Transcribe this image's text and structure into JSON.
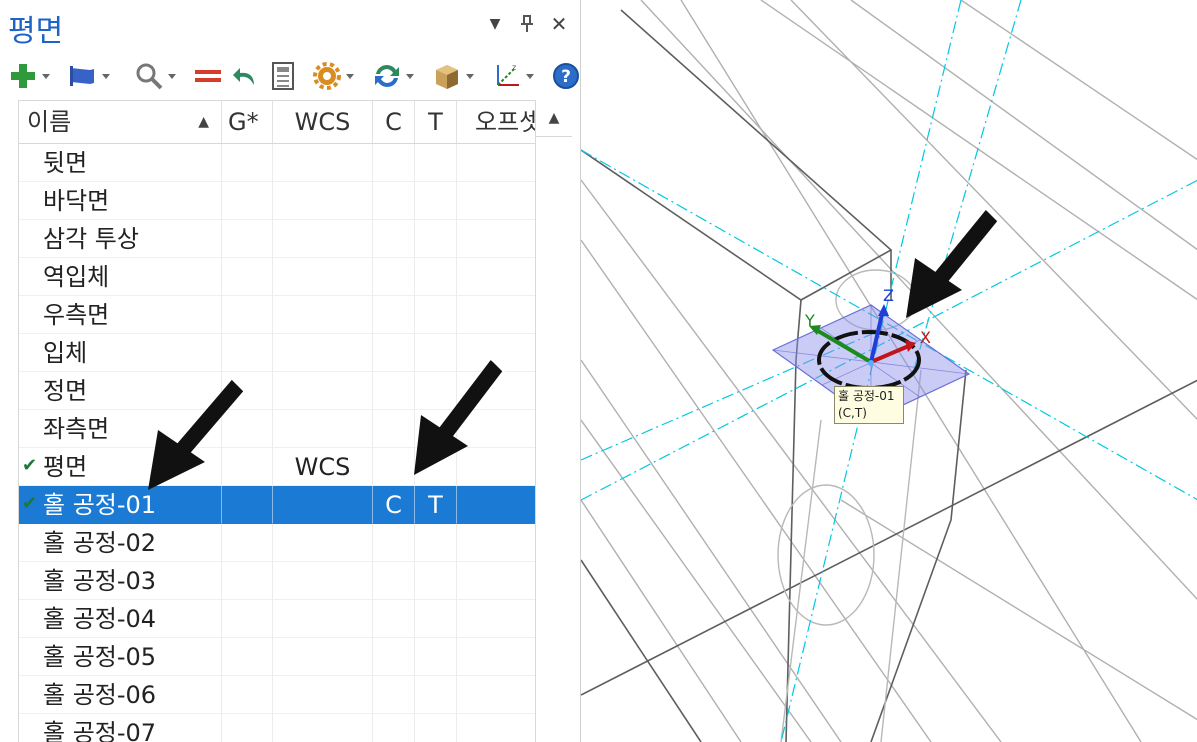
{
  "panel": {
    "title": "평면",
    "columns": [
      "이름",
      "G*",
      "WCS",
      "C",
      "T",
      "오프셋"
    ],
    "rows": [
      {
        "name": "뒷면",
        "g": "",
        "wcs": "",
        "c": "",
        "t": ""
      },
      {
        "name": "바닥면",
        "g": "",
        "wcs": "",
        "c": "",
        "t": ""
      },
      {
        "name": "삼각 투상",
        "g": "",
        "wcs": "",
        "c": "",
        "t": ""
      },
      {
        "name": "역입체",
        "g": "",
        "wcs": "",
        "c": "",
        "t": ""
      },
      {
        "name": "우측면",
        "g": "",
        "wcs": "",
        "c": "",
        "t": ""
      },
      {
        "name": "입체",
        "g": "",
        "wcs": "",
        "c": "",
        "t": ""
      },
      {
        "name": "정면",
        "g": "",
        "wcs": "",
        "c": "",
        "t": ""
      },
      {
        "name": "좌측면",
        "g": "",
        "wcs": "",
        "c": "",
        "t": ""
      },
      {
        "name": "평면",
        "g": "",
        "wcs": "WCS",
        "c": "",
        "t": "",
        "checked": true
      },
      {
        "name": "홀 공정-01",
        "g": "",
        "wcs": "",
        "c": "C",
        "t": "T",
        "checked": true,
        "selected": true
      },
      {
        "name": "홀 공정-02",
        "g": "",
        "wcs": "",
        "c": "",
        "t": ""
      },
      {
        "name": "홀 공정-03",
        "g": "",
        "wcs": "",
        "c": "",
        "t": ""
      },
      {
        "name": "홀 공정-04",
        "g": "",
        "wcs": "",
        "c": "",
        "t": ""
      },
      {
        "name": "홀 공정-05",
        "g": "",
        "wcs": "",
        "c": "",
        "t": ""
      },
      {
        "name": "홀 공정-06",
        "g": "",
        "wcs": "",
        "c": "",
        "t": ""
      },
      {
        "name": "홀 공정-07",
        "g": "",
        "wcs": "",
        "c": "",
        "t": ""
      }
    ]
  },
  "toolbar": {
    "icons": [
      "add-icon",
      "flag-icon",
      "search-icon",
      "equals-icon",
      "undo-icon",
      "calculator-icon",
      "gear-icon",
      "refresh-icon",
      "box-icon",
      "axes-icon",
      "help-icon"
    ]
  },
  "viewport": {
    "tooltip": {
      "line1": "홀 공정-01",
      "line2": "(C,T)"
    },
    "axis_labels": {
      "x": "X",
      "y": "Y",
      "z": "Z"
    },
    "colors": {
      "x": "#c0161b",
      "y": "#1c8a1c",
      "z": "#1f3fd8",
      "plane": "#8a8fe8",
      "guide": "#00c8e0"
    }
  }
}
